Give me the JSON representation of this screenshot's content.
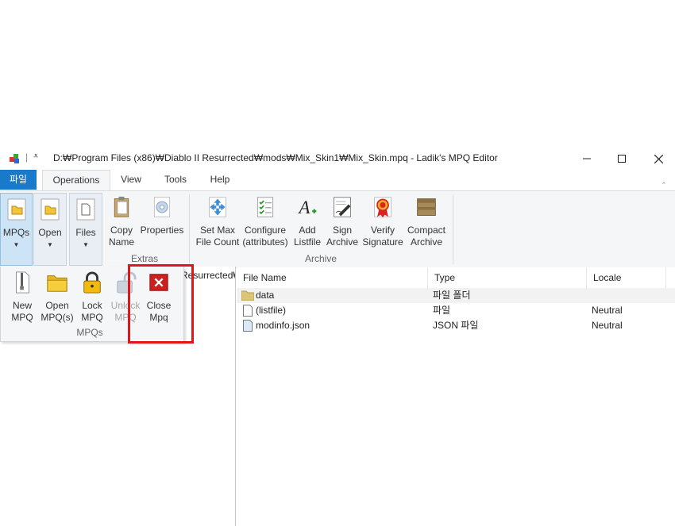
{
  "window": {
    "title": "D:₩Program Files (x86)₩Diablo II Resurrected₩mods₩Mix_Skin1₩Mix_Skin.mpq - Ladik's MPQ Editor",
    "qat_separator": "|",
    "qat_dropdown": "⩡"
  },
  "ribbon_tabs": [
    {
      "label": "파일"
    },
    {
      "label": "Operations"
    },
    {
      "label": "View"
    },
    {
      "label": "Tools"
    },
    {
      "label": "Help"
    }
  ],
  "ribbon": {
    "groups": {
      "mpqs_top": [
        {
          "label": "MPQs",
          "icon": "folder-icon",
          "dropdown": true
        },
        {
          "label": "Open",
          "icon": "folder-icon",
          "dropdown": true
        },
        {
          "label": "Files",
          "icon": "document-icon",
          "dropdown": true
        }
      ],
      "extras": {
        "label": "Extras",
        "buttons": [
          {
            "label": "Copy\nName",
            "icon": "clipboard-icon"
          },
          {
            "label": "Properties",
            "icon": "gear-icon"
          }
        ]
      },
      "archive": {
        "label": "Archive",
        "buttons": [
          {
            "label": "Set Max\nFile Count",
            "icon": "arrows-icon"
          },
          {
            "label": "Configure\n(attributes)",
            "icon": "checklist-icon"
          },
          {
            "label": "Add\nListfile",
            "icon": "font-add-icon"
          },
          {
            "label": "Sign\nArchive",
            "icon": "sign-icon"
          },
          {
            "label": "Verify\nSignature",
            "icon": "ribbon-award-icon"
          },
          {
            "label": "Compact\nArchive",
            "icon": "box-icon"
          }
        ]
      }
    }
  },
  "dropdown_panel": {
    "group_label": "MPQs",
    "buttons": [
      {
        "label": "New\nMPQ",
        "icon": "zip-file-icon"
      },
      {
        "label": "Open\nMPQ(s)",
        "icon": "open-folder-icon"
      },
      {
        "label": "Lock\nMPQ",
        "icon": "lock-icon"
      },
      {
        "label": "Unlock\nMPQ",
        "icon": "unlock-icon",
        "disabled": true
      },
      {
        "label": "Close\nMpq",
        "icon": "close-mpq-icon"
      }
    ]
  },
  "tree": {
    "visible_text": "Resurrected₩"
  },
  "listview": {
    "columns": [
      "File Name",
      "Type",
      "Locale"
    ],
    "rows": [
      {
        "name": "data",
        "type": "파일 폴더",
        "locale": "",
        "icon": "folder-icon"
      },
      {
        "name": "(listfile)",
        "type": "파일",
        "locale": "Neutral",
        "icon": "file-icon"
      },
      {
        "name": "modinfo.json",
        "type": "JSON 파일",
        "locale": "Neutral",
        "icon": "json-file-icon"
      }
    ]
  },
  "colors": {
    "accent": "#1979ca",
    "highlight": "#e3151b",
    "ribbon_bg": "#f5f6f7"
  }
}
